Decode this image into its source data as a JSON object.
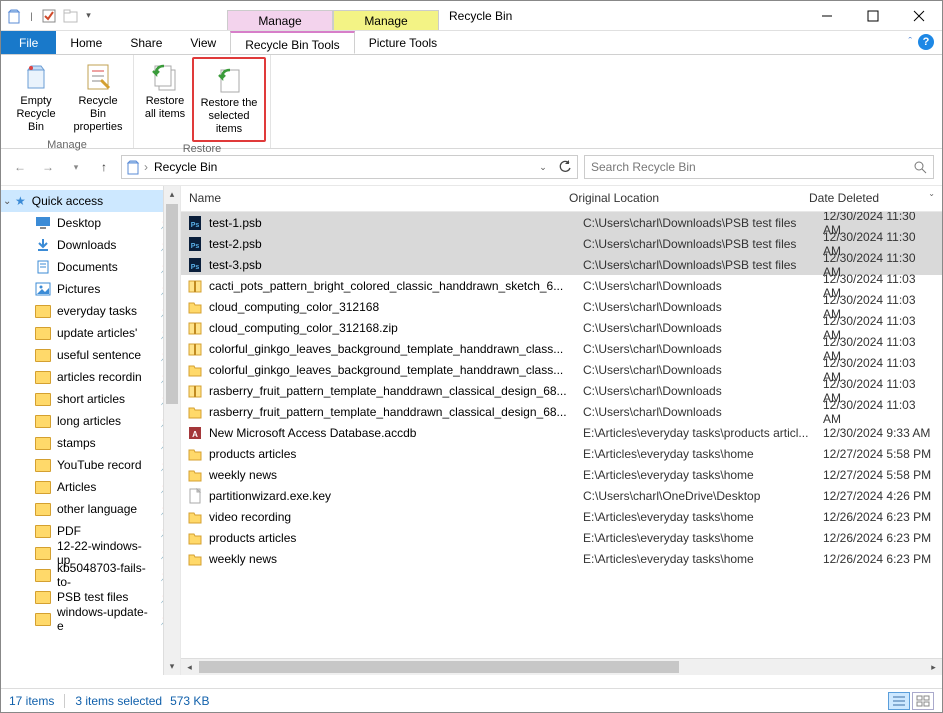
{
  "window": {
    "title": "Recycle Bin",
    "context_tabs": [
      {
        "label": "Manage",
        "group": "Recycle Bin Tools",
        "color": "pink"
      },
      {
        "label": "Manage",
        "group": "Picture Tools",
        "color": "yellow"
      }
    ]
  },
  "tabs": {
    "file": "File",
    "home": "Home",
    "share": "Share",
    "view": "View",
    "recycle_tools": "Recycle Bin Tools",
    "picture_tools": "Picture Tools"
  },
  "ribbon": {
    "manage": {
      "label": "Manage",
      "empty": "Empty Recycle Bin",
      "properties": "Recycle Bin properties"
    },
    "restore": {
      "label": "Restore",
      "all": "Restore all items",
      "selected": "Restore the selected items"
    }
  },
  "address": {
    "location": "Recycle Bin"
  },
  "search": {
    "placeholder": "Search Recycle Bin"
  },
  "nav": {
    "quick_access": "Quick access",
    "items": [
      {
        "label": "Desktop",
        "kind": "desktop"
      },
      {
        "label": "Downloads",
        "kind": "downloads"
      },
      {
        "label": "Documents",
        "kind": "documents"
      },
      {
        "label": "Pictures",
        "kind": "pictures"
      },
      {
        "label": "everyday tasks",
        "kind": "folder"
      },
      {
        "label": "update articles'",
        "kind": "folder"
      },
      {
        "label": "useful sentence",
        "kind": "folder"
      },
      {
        "label": "articles recordin",
        "kind": "folder"
      },
      {
        "label": "short articles",
        "kind": "folder"
      },
      {
        "label": "long articles",
        "kind": "folder"
      },
      {
        "label": "stamps",
        "kind": "folder"
      },
      {
        "label": "YouTube record",
        "kind": "folder"
      },
      {
        "label": "Articles",
        "kind": "folder"
      },
      {
        "label": "other language",
        "kind": "folder"
      },
      {
        "label": "PDF",
        "kind": "folder"
      },
      {
        "label": "12-22-windows-up",
        "kind": "folder"
      },
      {
        "label": "kb5048703-fails-to-",
        "kind": "folder"
      },
      {
        "label": "PSB test files",
        "kind": "folder"
      },
      {
        "label": "windows-update-e",
        "kind": "folder"
      }
    ]
  },
  "columns": {
    "name": "Name",
    "location": "Original Location",
    "date": "Date Deleted"
  },
  "files": [
    {
      "name": "test-1.psb",
      "loc": "C:\\Users\\charl\\Downloads\\PSB test files",
      "date": "12/30/2024 11:30 AM",
      "icon": "psb",
      "sel": true
    },
    {
      "name": "test-2.psb",
      "loc": "C:\\Users\\charl\\Downloads\\PSB test files",
      "date": "12/30/2024 11:30 AM",
      "icon": "psb",
      "sel": true
    },
    {
      "name": "test-3.psb",
      "loc": "C:\\Users\\charl\\Downloads\\PSB test files",
      "date": "12/30/2024 11:30 AM",
      "icon": "psb",
      "sel": true
    },
    {
      "name": "cacti_pots_pattern_bright_colored_classic_handdrawn_sketch_6...",
      "loc": "C:\\Users\\charl\\Downloads",
      "date": "12/30/2024 11:03 AM",
      "icon": "zip",
      "sel": false
    },
    {
      "name": "cloud_computing_color_312168",
      "loc": "C:\\Users\\charl\\Downloads",
      "date": "12/30/2024 11:03 AM",
      "icon": "folder",
      "sel": false
    },
    {
      "name": "cloud_computing_color_312168.zip",
      "loc": "C:\\Users\\charl\\Downloads",
      "date": "12/30/2024 11:03 AM",
      "icon": "zip",
      "sel": false
    },
    {
      "name": "colorful_ginkgo_leaves_background_template_handdrawn_class...",
      "loc": "C:\\Users\\charl\\Downloads",
      "date": "12/30/2024 11:03 AM",
      "icon": "zip",
      "sel": false
    },
    {
      "name": "colorful_ginkgo_leaves_background_template_handdrawn_class...",
      "loc": "C:\\Users\\charl\\Downloads",
      "date": "12/30/2024 11:03 AM",
      "icon": "folder",
      "sel": false
    },
    {
      "name": "rasberry_fruit_pattern_template_handdrawn_classical_design_68...",
      "loc": "C:\\Users\\charl\\Downloads",
      "date": "12/30/2024 11:03 AM",
      "icon": "zip",
      "sel": false
    },
    {
      "name": "rasberry_fruit_pattern_template_handdrawn_classical_design_68...",
      "loc": "C:\\Users\\charl\\Downloads",
      "date": "12/30/2024 11:03 AM",
      "icon": "folder",
      "sel": false
    },
    {
      "name": "New Microsoft Access Database.accdb",
      "loc": "E:\\Articles\\everyday tasks\\products articl...",
      "date": "12/30/2024 9:33 AM",
      "icon": "accdb",
      "sel": false
    },
    {
      "name": "products articles",
      "loc": "E:\\Articles\\everyday tasks\\home",
      "date": "12/27/2024 5:58 PM",
      "icon": "folder",
      "sel": false
    },
    {
      "name": "weekly news",
      "loc": "E:\\Articles\\everyday tasks\\home",
      "date": "12/27/2024 5:58 PM",
      "icon": "folder",
      "sel": false
    },
    {
      "name": "partitionwizard.exe.key",
      "loc": "C:\\Users\\charl\\OneDrive\\Desktop",
      "date": "12/27/2024 4:26 PM",
      "icon": "file",
      "sel": false
    },
    {
      "name": "video recording",
      "loc": "E:\\Articles\\everyday tasks\\home",
      "date": "12/26/2024 6:23 PM",
      "icon": "folder",
      "sel": false
    },
    {
      "name": "products articles",
      "loc": "E:\\Articles\\everyday tasks\\home",
      "date": "12/26/2024 6:23 PM",
      "icon": "folder",
      "sel": false
    },
    {
      "name": "weekly news",
      "loc": "E:\\Articles\\everyday tasks\\home",
      "date": "12/26/2024 6:23 PM",
      "icon": "folder",
      "sel": false
    }
  ],
  "status": {
    "count": "17 items",
    "selection": "3 items selected",
    "size": "573 KB"
  }
}
